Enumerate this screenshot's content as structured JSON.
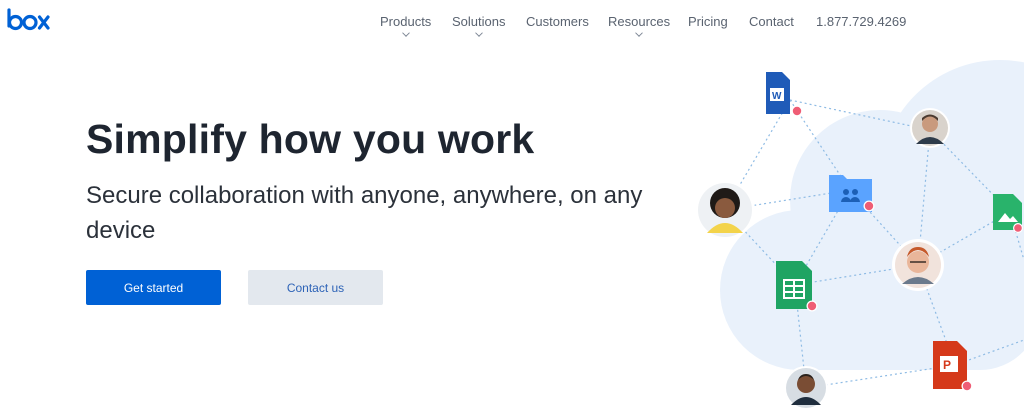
{
  "brand": {
    "logo_text": "box",
    "color": "#0061d5"
  },
  "nav": {
    "items": [
      {
        "label": "Products",
        "has_dropdown": true
      },
      {
        "label": "Solutions",
        "has_dropdown": true
      },
      {
        "label": "Customers",
        "has_dropdown": false
      },
      {
        "label": "Resources",
        "has_dropdown": true
      },
      {
        "label": "Pricing",
        "has_dropdown": false
      },
      {
        "label": "Contact",
        "has_dropdown": false
      }
    ],
    "phone": "1.877.729.4269"
  },
  "hero": {
    "title": "Simplify how you work",
    "subtitle": "Secure collaboration with anyone, anywhere, on any device"
  },
  "buttons": {
    "get_started": "Get started",
    "contact_us": "Contact us"
  },
  "illustration": {
    "files": [
      {
        "type": "word",
        "icon": "word-file-icon",
        "letter": "W",
        "color": "#1f5bb8"
      },
      {
        "type": "folder",
        "icon": "shared-folder-icon",
        "color": "#5aa3ff"
      },
      {
        "type": "sheet",
        "icon": "sheets-file-icon",
        "color": "#1fa463"
      },
      {
        "type": "powerpoint",
        "icon": "powerpoint-file-icon",
        "letter": "P",
        "color": "#d5391a"
      },
      {
        "type": "image",
        "icon": "image-file-icon",
        "color": "#29b36b"
      }
    ],
    "people": [
      {
        "icon": "user-avatar-man-glasses-icon"
      },
      {
        "icon": "user-avatar-woman-icon"
      },
      {
        "icon": "user-avatar-man-red-hair-icon"
      },
      {
        "icon": "user-avatar-man-suit-icon"
      }
    ],
    "lock_badge_color": "#ef5d75"
  }
}
